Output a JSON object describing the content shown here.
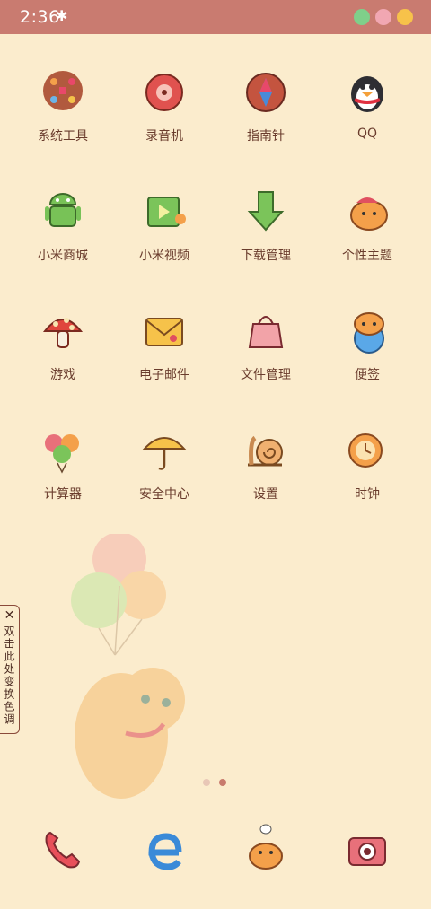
{
  "status": {
    "time": "2:36",
    "bluetooth_icon": "bluetooth-icon"
  },
  "apps": [
    {
      "label": "系统工具",
      "icon": "tools-folder-icon"
    },
    {
      "label": "录音机",
      "icon": "recorder-icon"
    },
    {
      "label": "指南针",
      "icon": "compass-icon"
    },
    {
      "label": "QQ",
      "icon": "penguin-icon"
    },
    {
      "label": "小米商城",
      "icon": "android-icon"
    },
    {
      "label": "小米视频",
      "icon": "video-icon"
    },
    {
      "label": "下载管理",
      "icon": "download-arrow-icon"
    },
    {
      "label": "个性主题",
      "icon": "cat-theme-icon"
    },
    {
      "label": "游戏",
      "icon": "mushroom-icon"
    },
    {
      "label": "电子邮件",
      "icon": "envelope-icon"
    },
    {
      "label": "文件管理",
      "icon": "file-bag-icon"
    },
    {
      "label": "便签",
      "icon": "cat-note-icon"
    },
    {
      "label": "计算器",
      "icon": "balloons-calc-icon"
    },
    {
      "label": "安全中心",
      "icon": "umbrella-icon"
    },
    {
      "label": "设置",
      "icon": "snail-icon"
    },
    {
      "label": "时钟",
      "icon": "cat-clock-icon"
    }
  ],
  "side_handle": {
    "close": "✕",
    "text": "双击此处变换色调"
  },
  "pages": {
    "count": 2,
    "active": 2
  },
  "dock": [
    {
      "icon": "phone-icon"
    },
    {
      "icon": "browser-e-icon"
    },
    {
      "icon": "cat-messages-icon"
    },
    {
      "icon": "camera-icon"
    }
  ],
  "colors": {
    "statusbar": "#c97b70",
    "background": "#fbeccd",
    "label": "#6a3c2d"
  }
}
